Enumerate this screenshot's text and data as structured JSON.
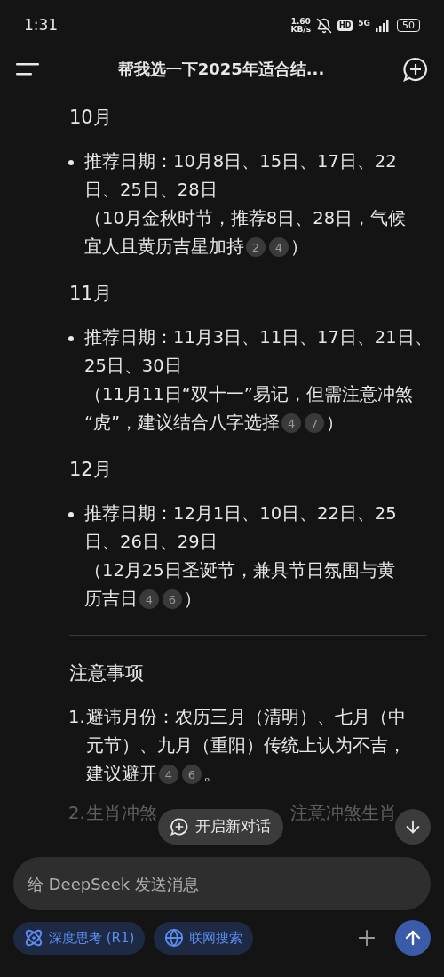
{
  "status_bar": {
    "time": "1:31",
    "speed_value": "1.60",
    "speed_unit": "KB/s",
    "hd": "HD",
    "network": "5G",
    "battery": "50"
  },
  "header": {
    "title": "帮我选一下2025年适合结..."
  },
  "sections": [
    {
      "heading": "10月",
      "bullet_lines": [
        "推荐日期：10月8日、15日、17日、22",
        "日、25日、28日"
      ],
      "note_lines": [
        "（10月金秋时节，推荐8日、28日，气候",
        "宜人且黄历吉星加持"
      ],
      "citations": [
        "2",
        "4"
      ],
      "tail": "）"
    },
    {
      "heading": "11月",
      "bullet_lines": [
        "推荐日期：11月3日、11日、17日、21日、",
        "25日、30日"
      ],
      "note_lines": [
        "（11月11日“双十一”易记，但需注意冲煞",
        "“虎”，建议结合八字选择"
      ],
      "citations": [
        "4",
        "7"
      ],
      "tail": "）"
    },
    {
      "heading": "12月",
      "bullet_lines": [
        "推荐日期：12月1日、10日、22日、25",
        "日、26日、29日"
      ],
      "note_lines": [
        "（12月25日圣诞节，兼具节日氛围与黄",
        "历吉日"
      ],
      "citations": [
        "4",
        "6"
      ],
      "tail": "）"
    }
  ],
  "notes": {
    "heading": "注意事项",
    "items": [
      {
        "number": "1.",
        "lines": [
          "避讳月份：农历三月（清明）、七月（中",
          "元节）、九月（重阳）传统上认为不吉，",
          "建议避开"
        ],
        "citations": [
          "4",
          "6"
        ],
        "tail": "。"
      },
      {
        "number": "2.",
        "fragments": [
          "生肖冲煞",
          "注意冲煞生肖"
        ]
      }
    ]
  },
  "new_chat": {
    "label": "开启新对话"
  },
  "composer": {
    "placeholder": "给 DeepSeek 发送消息"
  },
  "toggles": [
    {
      "label": "深度思考 (R1)"
    },
    {
      "label": "联网搜索"
    }
  ]
}
